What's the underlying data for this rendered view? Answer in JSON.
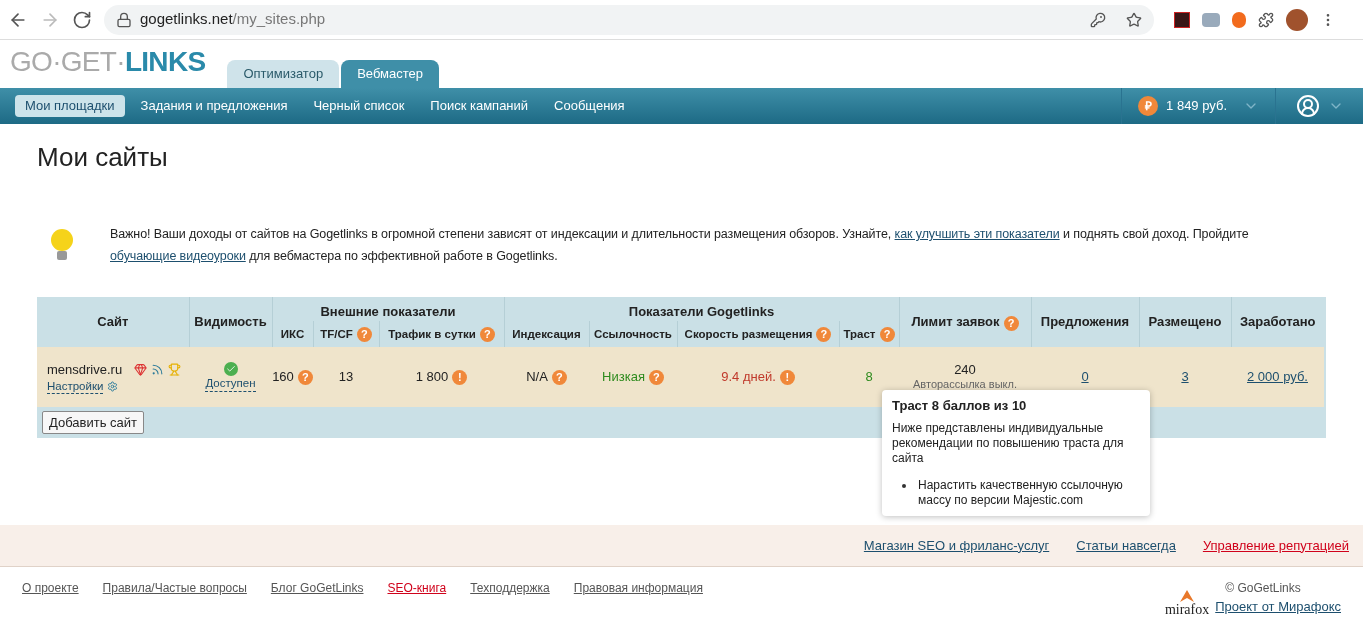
{
  "browser": {
    "url_host": "gogetlinks.net",
    "url_path": "/my_sites.php"
  },
  "logo": {
    "part_1": "GO·GET·",
    "part_2": "LINKS"
  },
  "tabs": [
    {
      "label": "Оптимизатор",
      "selected": false
    },
    {
      "label": "Вебмастер",
      "selected": true
    }
  ],
  "nav": [
    {
      "label": "Мои площадки",
      "selected": true
    },
    {
      "label": "Задания и предложения",
      "selected": false
    },
    {
      "label": "Черный список",
      "selected": false
    },
    {
      "label": "Поиск кампаний",
      "selected": false
    },
    {
      "label": "Сообщения",
      "selected": false
    }
  ],
  "currency_sign": "₽",
  "balance": "1 849 руб.",
  "page_title": "Мои сайты",
  "notice": [
    {
      "kind": "text",
      "text": "Важно! Ваши доходы от сайтов на Gogetlinks в огромной степени зависят от индексации и длительности размещения обзоров. Узнайте, "
    },
    {
      "kind": "link",
      "text": "как улучшить эти показатели"
    },
    {
      "kind": "text",
      "text": " и поднять свой доход. Пройдите "
    },
    {
      "kind": "link",
      "text": "обучающие видеоуроки"
    },
    {
      "kind": "text",
      "text": " для вебмастера по эффективной работе в Gogetlinks."
    }
  ],
  "table": {
    "columns_left": [
      {
        "label": "Сайт"
      },
      {
        "label": "Видимость"
      }
    ],
    "groups": [
      {
        "label": "Внешние показатели",
        "columns": [
          {
            "label": "ИКС"
          },
          {
            "label": "TF/CF",
            "hint": "?"
          },
          {
            "label": "Трафик в сутки",
            "hint": "?"
          }
        ]
      },
      {
        "label": "Показатели Gogetlinks",
        "columns": [
          {
            "label": "Индексация"
          },
          {
            "label": "Ссылочность"
          },
          {
            "label": "Скорость размещения",
            "hint": "?"
          },
          {
            "label": "Траст",
            "hint": "?"
          }
        ]
      }
    ],
    "columns_right": [
      {
        "label": "Лимит заявок",
        "hint": "?"
      },
      {
        "label": "Предложения"
      },
      {
        "label": "Размещено"
      },
      {
        "label": "Заработано"
      }
    ],
    "row": {
      "site": "mensdrive.ru",
      "settings": "Настройки",
      "visibility": "Доступен",
      "cells": [
        {
          "kind": "plain",
          "text": "160",
          "hint": "?"
        },
        {
          "kind": "plain",
          "text": "13"
        },
        {
          "kind": "plain",
          "text": "1 800",
          "hint": "!"
        },
        {
          "kind": "plain",
          "text": "N/A",
          "hint": "?"
        },
        {
          "kind": "plain",
          "text": "Низкая",
          "hint": "?",
          "color": "#2e8b1e"
        },
        {
          "kind": "plain",
          "text": "9.4 дней.",
          "hint": "!",
          "color": "#c0392b"
        },
        {
          "kind": "plain",
          "text": "8",
          "color": "#2e8b1e"
        },
        {
          "kind": "limit",
          "text": "240",
          "sub": "Авторассылка выкл."
        },
        {
          "kind": "link",
          "text": "0"
        },
        {
          "kind": "link",
          "text": "3"
        },
        {
          "kind": "link",
          "text": "2 000 руб."
        }
      ]
    },
    "add_button": "Добавить сайт"
  },
  "tooltip": {
    "title": "Траст 8 баллов из 10",
    "text": "Ниже представлены индивидуальные рекомендации по повышению траста для сайта",
    "items": [
      "Нарастить качественную ссылочную массу по версии Majestic.com"
    ]
  },
  "footer_top": [
    {
      "text": "Магазин SEO и фриланс-услуг",
      "color": "#1d4f6e"
    },
    {
      "text": "Статьи навсегда",
      "color": "#1d4f6e"
    },
    {
      "text": "Управление репутацией",
      "color": "#d0021b"
    }
  ],
  "footer_links": [
    {
      "text": "О проекте",
      "color": "#555555"
    },
    {
      "text": "Правила/Частые вопросы",
      "color": "#555555"
    },
    {
      "text": "Блог GoGetLinks",
      "color": "#555555"
    },
    {
      "text": "SEO-книга",
      "color": "#d0021b"
    },
    {
      "text": "Техподдержка",
      "color": "#555555"
    },
    {
      "text": "Правовая информация",
      "color": "#555555"
    }
  ],
  "mirafox": {
    "logo": "mirafox",
    "copyright": "© GoGetLinks",
    "link": "Проект от Мирафокс"
  }
}
